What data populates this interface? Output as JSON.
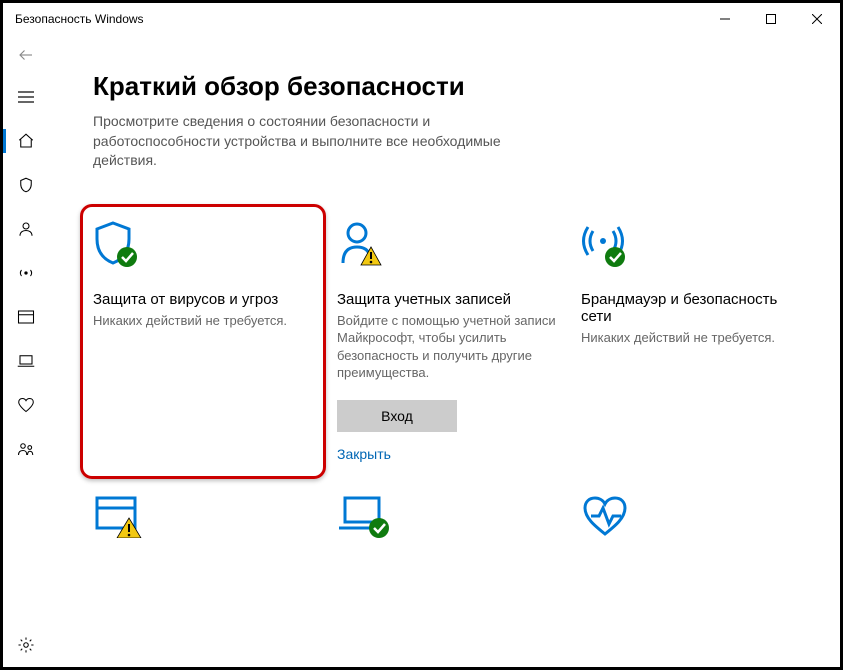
{
  "window": {
    "title": "Безопасность Windows"
  },
  "page": {
    "title": "Краткий обзор безопасности",
    "description": "Просмотрите сведения о состоянии безопасности и работоспособности устройства и выполните все необходимые действия."
  },
  "tiles": {
    "virus": {
      "title": "Защита от вирусов и угроз",
      "sub": "Никаких действий не требуется."
    },
    "account": {
      "title": "Защита учетных записей",
      "sub": "Войдите с помощью учетной записи Майкрософт, чтобы усилить безопасность и получить другие преимущества.",
      "button": "Вход",
      "link": "Закрыть"
    },
    "firewall": {
      "title": "Брандмауэр и безопасность сети",
      "sub": "Никаких действий не требуется."
    }
  },
  "colors": {
    "accent": "#0078d4",
    "highlight": "#cc0000",
    "ok": "#0f7b0f",
    "warn": "#f2c811"
  }
}
